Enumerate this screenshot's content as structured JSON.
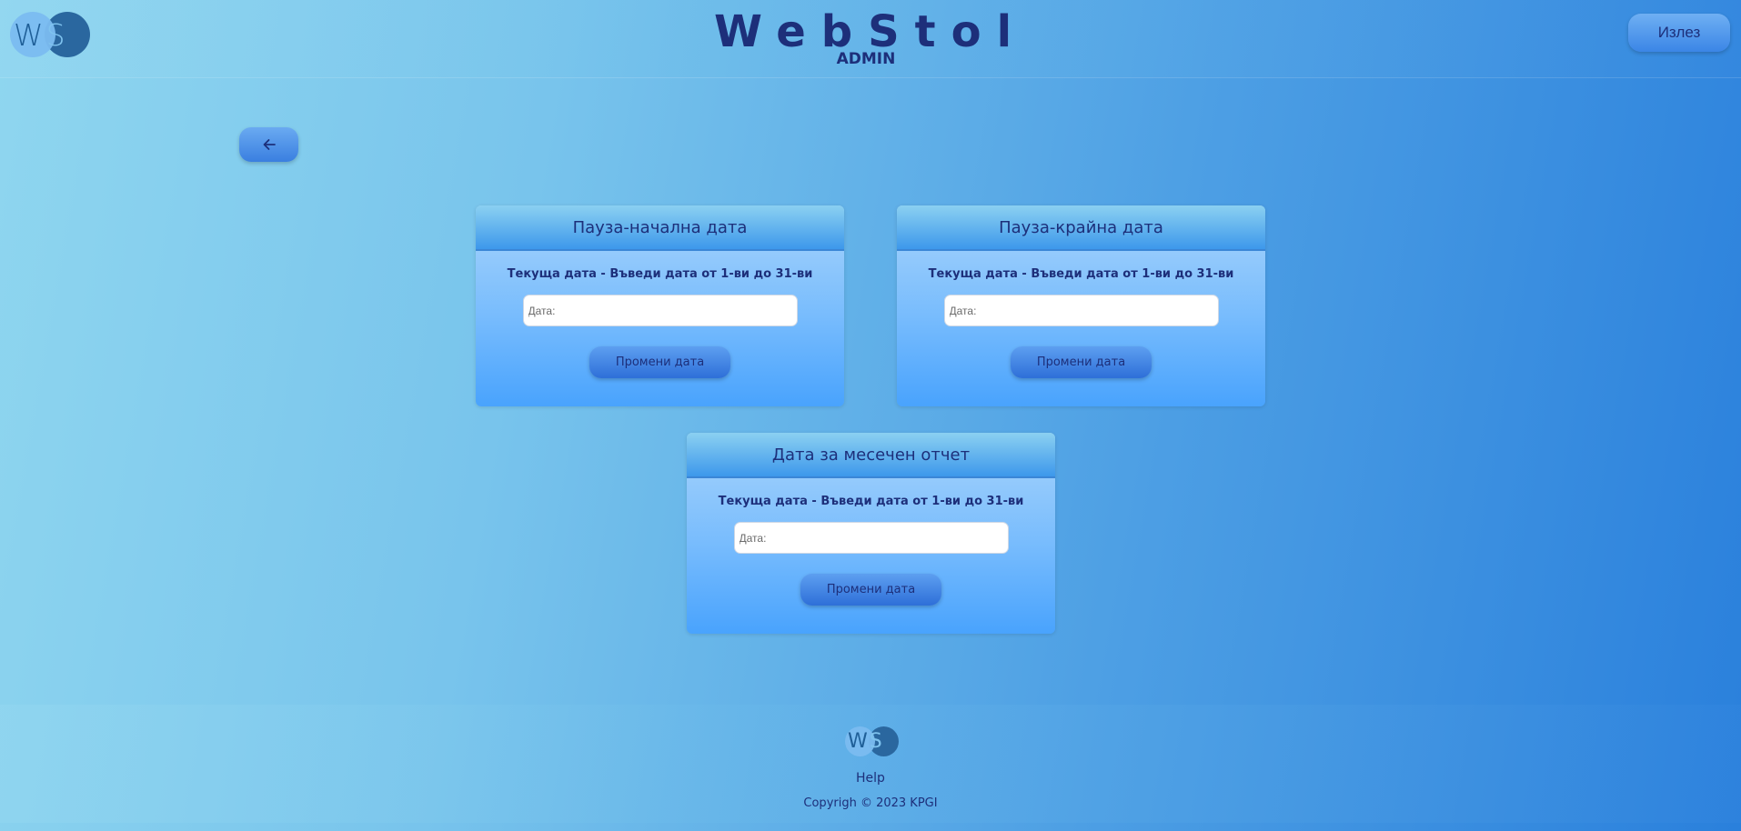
{
  "header": {
    "logo_letters": [
      "W",
      "S"
    ],
    "title": "WebStol",
    "subtitle": "ADMIN",
    "logout_label": "Излез"
  },
  "nav": {
    "back_icon": "arrow-left-icon"
  },
  "cards": [
    {
      "title": "Пауза-начална дата",
      "note": "Текуща дата - Въведи дата от 1-ви до 31-ви",
      "input_placeholder": "Дата:",
      "input_value": "",
      "button_label": "Промени дата"
    },
    {
      "title": "Пауза-крайна дата",
      "note": "Текуща дата - Въведи дата от 1-ви до 31-ви",
      "input_placeholder": "Дата:",
      "input_value": "",
      "button_label": "Промени дата"
    },
    {
      "title": "Дата за месечен отчет",
      "note": "Текуща дата - Въведи дата от 1-ви до 31-ви",
      "input_placeholder": "Дата:",
      "input_value": "",
      "button_label": "Промени дата"
    }
  ],
  "footer": {
    "logo_letters": [
      "W",
      "S"
    ],
    "help_label": "Help",
    "copyright": "Copyrigh © 2023 KPGI"
  },
  "colors": {
    "text_primary": "#1d2f7a",
    "accent": "#3b86e6",
    "background_start": "#8fd6ef",
    "background_end": "#2a80dc"
  }
}
